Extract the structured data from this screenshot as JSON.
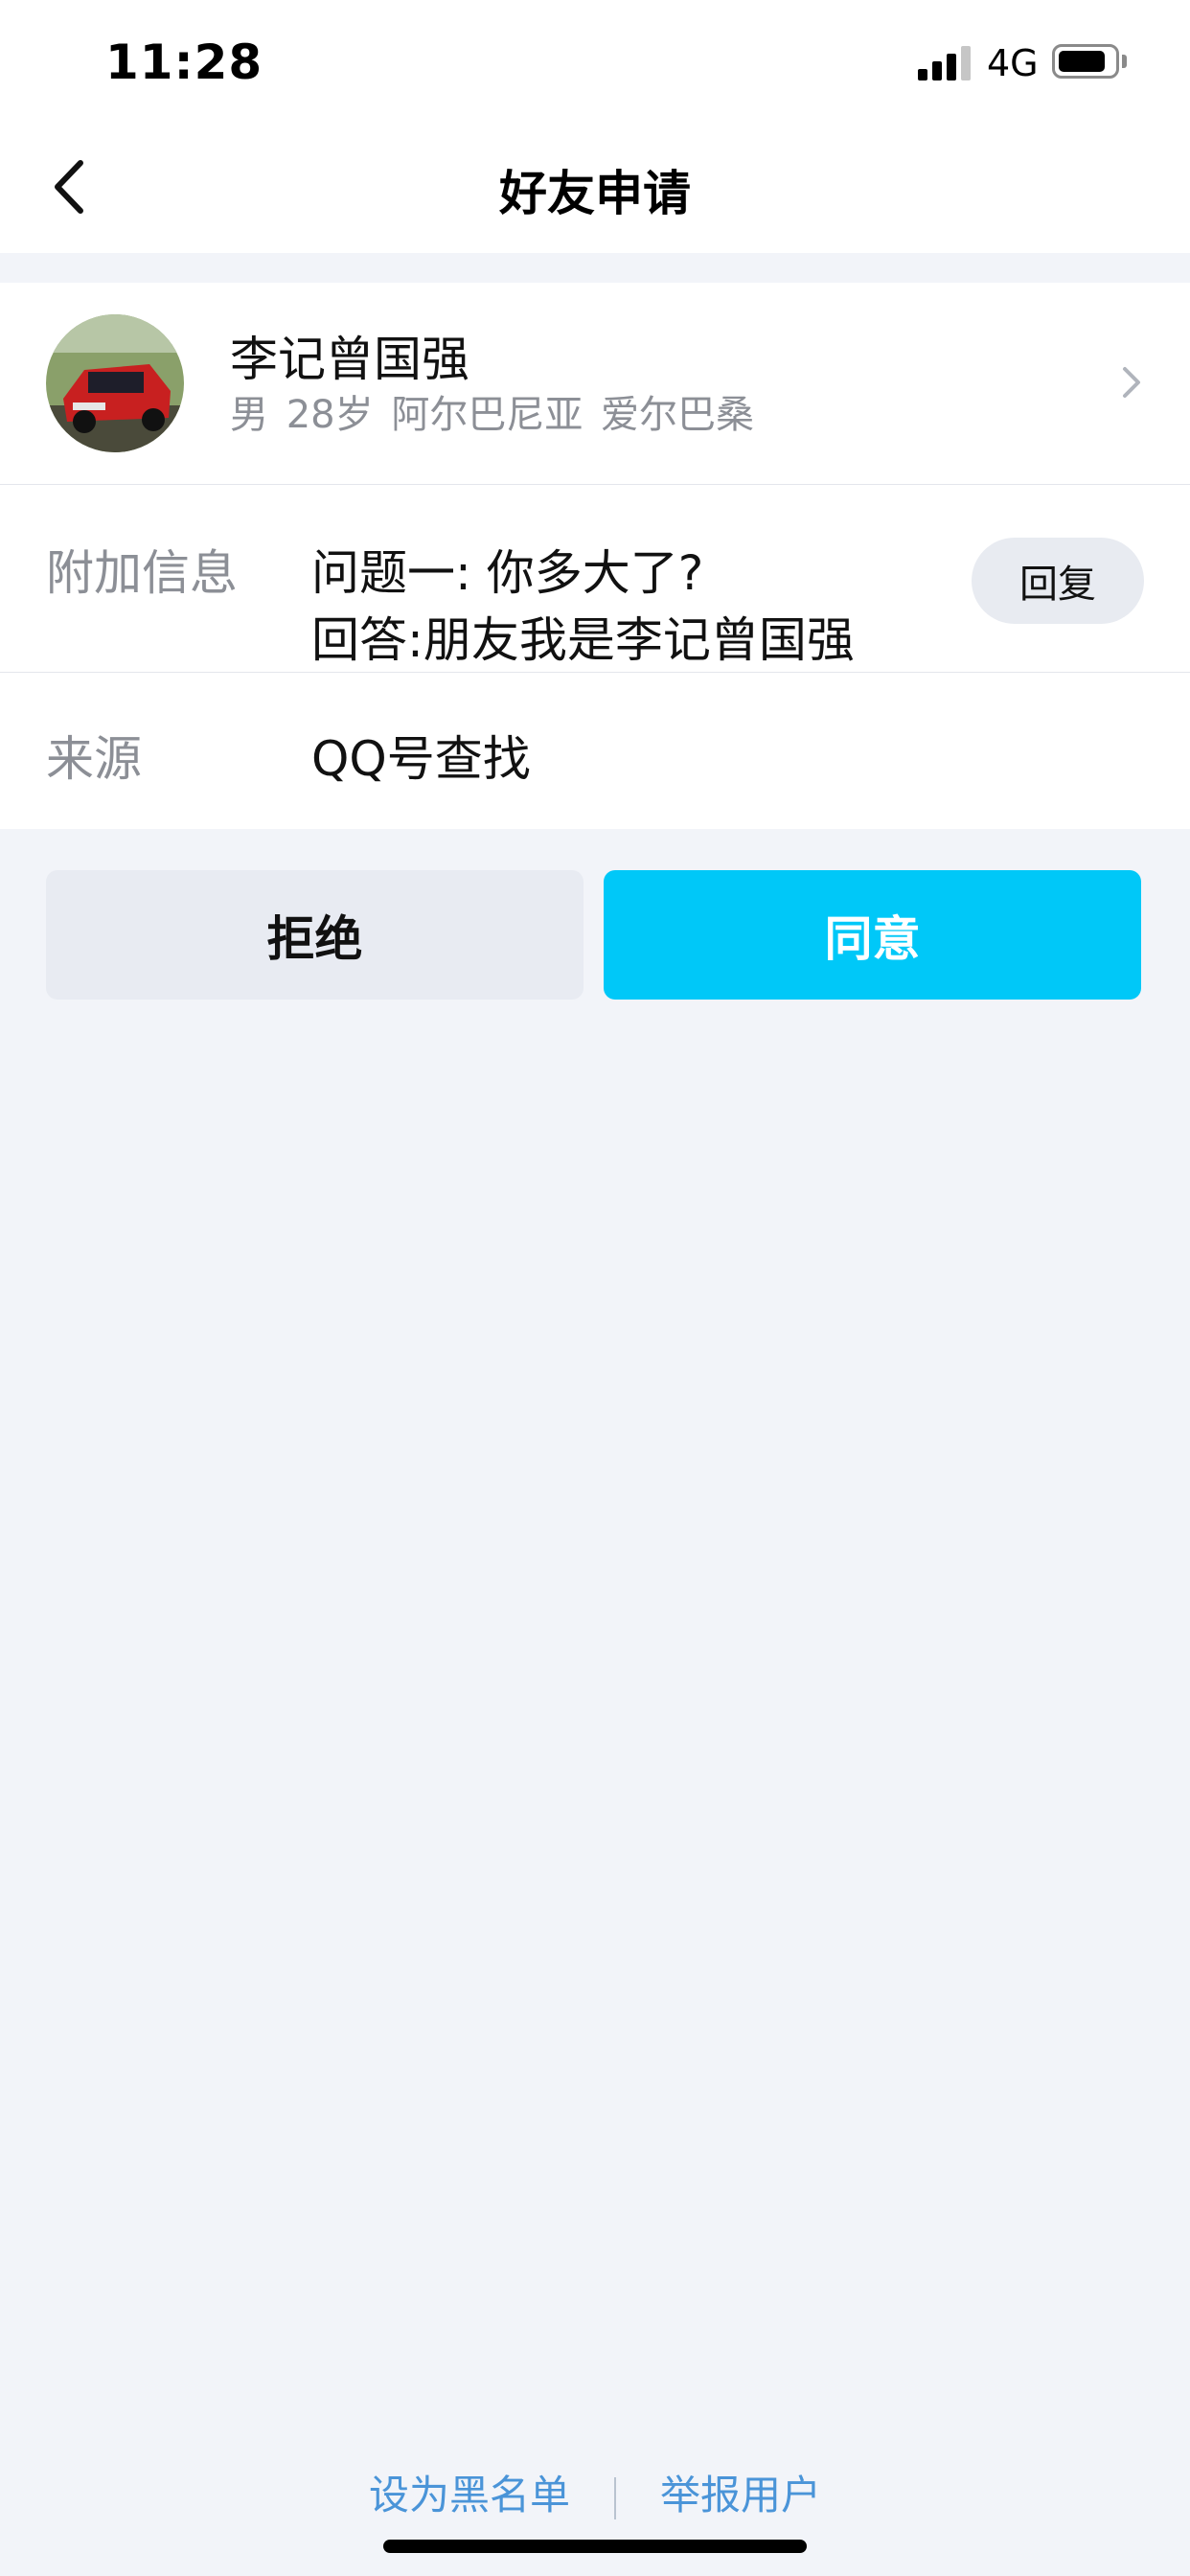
{
  "status_bar": {
    "time": "11:28",
    "network": "4G"
  },
  "header": {
    "title": "好友申请"
  },
  "profile": {
    "name": "李记曾国强",
    "meta": "男  28岁  阿尔巴尼亚 爱尔巴桑"
  },
  "extra_info": {
    "label": "附加信息",
    "question": "问题一: 你多大了?",
    "answer": "回答:朋友我是李记曾国强",
    "reply_label": "回复"
  },
  "source": {
    "label": "来源",
    "value": "QQ号查找"
  },
  "actions": {
    "reject_label": "拒绝",
    "accept_label": "同意"
  },
  "footer": {
    "blacklist_label": "设为黑名单",
    "report_label": "举报用户"
  },
  "colors": {
    "accent": "#00c8f8",
    "link": "#4a94d8",
    "background": "#f2f4f9"
  }
}
